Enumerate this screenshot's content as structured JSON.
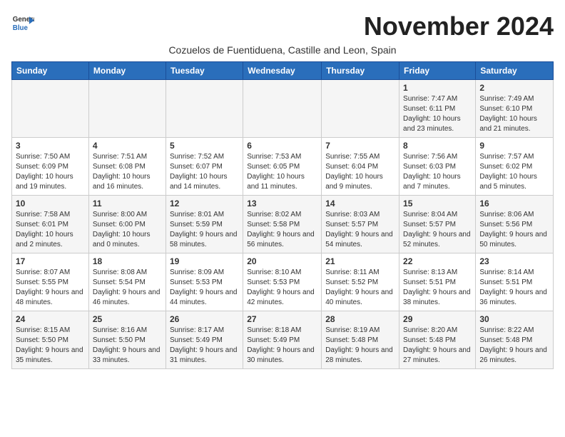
{
  "logo": {
    "general": "General",
    "blue": "Blue"
  },
  "title": "November 2024",
  "subtitle": "Cozuelos de Fuentiduena, Castille and Leon, Spain",
  "days_header": [
    "Sunday",
    "Monday",
    "Tuesday",
    "Wednesday",
    "Thursday",
    "Friday",
    "Saturday"
  ],
  "weeks": [
    [
      {
        "day": "",
        "info": ""
      },
      {
        "day": "",
        "info": ""
      },
      {
        "day": "",
        "info": ""
      },
      {
        "day": "",
        "info": ""
      },
      {
        "day": "",
        "info": ""
      },
      {
        "day": "1",
        "info": "Sunrise: 7:47 AM\nSunset: 6:11 PM\nDaylight: 10 hours and 23 minutes."
      },
      {
        "day": "2",
        "info": "Sunrise: 7:49 AM\nSunset: 6:10 PM\nDaylight: 10 hours and 21 minutes."
      }
    ],
    [
      {
        "day": "3",
        "info": "Sunrise: 7:50 AM\nSunset: 6:09 PM\nDaylight: 10 hours and 19 minutes."
      },
      {
        "day": "4",
        "info": "Sunrise: 7:51 AM\nSunset: 6:08 PM\nDaylight: 10 hours and 16 minutes."
      },
      {
        "day": "5",
        "info": "Sunrise: 7:52 AM\nSunset: 6:07 PM\nDaylight: 10 hours and 14 minutes."
      },
      {
        "day": "6",
        "info": "Sunrise: 7:53 AM\nSunset: 6:05 PM\nDaylight: 10 hours and 11 minutes."
      },
      {
        "day": "7",
        "info": "Sunrise: 7:55 AM\nSunset: 6:04 PM\nDaylight: 10 hours and 9 minutes."
      },
      {
        "day": "8",
        "info": "Sunrise: 7:56 AM\nSunset: 6:03 PM\nDaylight: 10 hours and 7 minutes."
      },
      {
        "day": "9",
        "info": "Sunrise: 7:57 AM\nSunset: 6:02 PM\nDaylight: 10 hours and 5 minutes."
      }
    ],
    [
      {
        "day": "10",
        "info": "Sunrise: 7:58 AM\nSunset: 6:01 PM\nDaylight: 10 hours and 2 minutes."
      },
      {
        "day": "11",
        "info": "Sunrise: 8:00 AM\nSunset: 6:00 PM\nDaylight: 10 hours and 0 minutes."
      },
      {
        "day": "12",
        "info": "Sunrise: 8:01 AM\nSunset: 5:59 PM\nDaylight: 9 hours and 58 minutes."
      },
      {
        "day": "13",
        "info": "Sunrise: 8:02 AM\nSunset: 5:58 PM\nDaylight: 9 hours and 56 minutes."
      },
      {
        "day": "14",
        "info": "Sunrise: 8:03 AM\nSunset: 5:57 PM\nDaylight: 9 hours and 54 minutes."
      },
      {
        "day": "15",
        "info": "Sunrise: 8:04 AM\nSunset: 5:57 PM\nDaylight: 9 hours and 52 minutes."
      },
      {
        "day": "16",
        "info": "Sunrise: 8:06 AM\nSunset: 5:56 PM\nDaylight: 9 hours and 50 minutes."
      }
    ],
    [
      {
        "day": "17",
        "info": "Sunrise: 8:07 AM\nSunset: 5:55 PM\nDaylight: 9 hours and 48 minutes."
      },
      {
        "day": "18",
        "info": "Sunrise: 8:08 AM\nSunset: 5:54 PM\nDaylight: 9 hours and 46 minutes."
      },
      {
        "day": "19",
        "info": "Sunrise: 8:09 AM\nSunset: 5:53 PM\nDaylight: 9 hours and 44 minutes."
      },
      {
        "day": "20",
        "info": "Sunrise: 8:10 AM\nSunset: 5:53 PM\nDaylight: 9 hours and 42 minutes."
      },
      {
        "day": "21",
        "info": "Sunrise: 8:11 AM\nSunset: 5:52 PM\nDaylight: 9 hours and 40 minutes."
      },
      {
        "day": "22",
        "info": "Sunrise: 8:13 AM\nSunset: 5:51 PM\nDaylight: 9 hours and 38 minutes."
      },
      {
        "day": "23",
        "info": "Sunrise: 8:14 AM\nSunset: 5:51 PM\nDaylight: 9 hours and 36 minutes."
      }
    ],
    [
      {
        "day": "24",
        "info": "Sunrise: 8:15 AM\nSunset: 5:50 PM\nDaylight: 9 hours and 35 minutes."
      },
      {
        "day": "25",
        "info": "Sunrise: 8:16 AM\nSunset: 5:50 PM\nDaylight: 9 hours and 33 minutes."
      },
      {
        "day": "26",
        "info": "Sunrise: 8:17 AM\nSunset: 5:49 PM\nDaylight: 9 hours and 31 minutes."
      },
      {
        "day": "27",
        "info": "Sunrise: 8:18 AM\nSunset: 5:49 PM\nDaylight: 9 hours and 30 minutes."
      },
      {
        "day": "28",
        "info": "Sunrise: 8:19 AM\nSunset: 5:48 PM\nDaylight: 9 hours and 28 minutes."
      },
      {
        "day": "29",
        "info": "Sunrise: 8:20 AM\nSunset: 5:48 PM\nDaylight: 9 hours and 27 minutes."
      },
      {
        "day": "30",
        "info": "Sunrise: 8:22 AM\nSunset: 5:48 PM\nDaylight: 9 hours and 26 minutes."
      }
    ]
  ]
}
